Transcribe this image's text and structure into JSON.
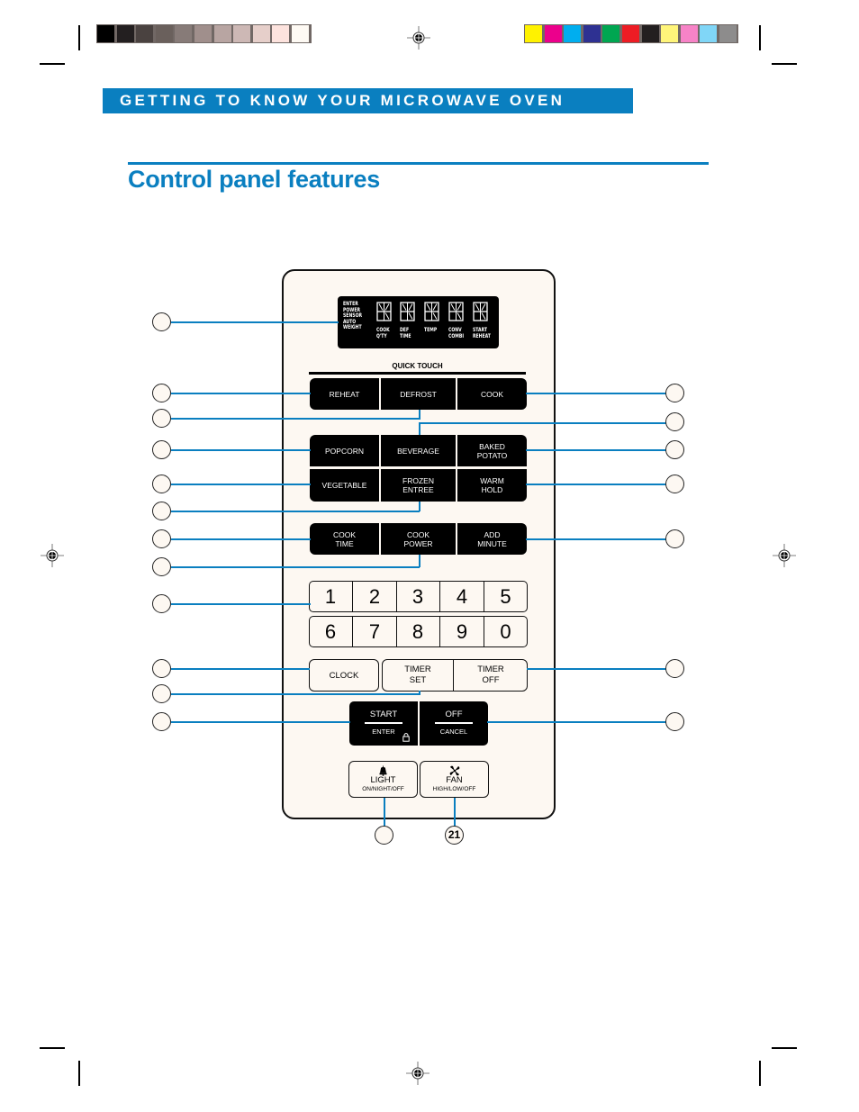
{
  "print_marks": {
    "gray_swatches": [
      "#000000",
      "#231f20",
      "#4a4240",
      "#6a605c",
      "#877b78",
      "#a08f8c",
      "#b8a5a2",
      "#cdb8b5",
      "#e6cfca",
      "#fde3de",
      "#fefaf4"
    ],
    "color_swatches": [
      "#fff200",
      "#ec008c",
      "#00aeef",
      "#2e3192",
      "#00a651",
      "#ed1c24",
      "#231f20",
      "#fff57a",
      "#f783c7",
      "#80d6f7",
      "#8d8c8c"
    ]
  },
  "header": {
    "section_banner": "GETTING TO KNOW YOUR MICROWAVE OVEN",
    "page_title": "Control panel features",
    "accent_color": "#0a7fc0"
  },
  "display": {
    "left_labels": "ENTER\nPOWER\nSENSOR\nAUTO\nWEIGHT",
    "digit_labels": [
      "COOK\nQ'TY",
      "DEF\nTIME",
      "TEMP",
      "CONV\nCOMBI",
      "START\nREHEAT"
    ]
  },
  "panel": {
    "quick_touch_label": "QUICK TOUCH",
    "row1": [
      "REHEAT",
      "DEFROST",
      "COOK"
    ],
    "row2": [
      "POPCORN",
      "BEVERAGE",
      "BAKED\nPOTATO"
    ],
    "row3": [
      "VEGETABLE",
      "FROZEN\nENTREE",
      "WARM\nHOLD"
    ],
    "row4": [
      "COOK\nTIME",
      "COOK\nPOWER",
      "ADD\nMINUTE"
    ],
    "keypad_row1": [
      "1",
      "2",
      "3",
      "4",
      "5"
    ],
    "keypad_row2": [
      "6",
      "7",
      "8",
      "9",
      "0"
    ],
    "clock": "CLOCK",
    "timer_set": "TIMER\nSET",
    "timer_off": "TIMER\nOFF",
    "start": {
      "label": "START",
      "sub": "ENTER"
    },
    "off": {
      "label": "OFF",
      "sub": "CANCEL"
    },
    "light": {
      "label": "LIGHT",
      "sub": "ON/NIGHT/OFF"
    },
    "fan": {
      "label": "FAN",
      "sub": "HIGH/LOW/OFF"
    }
  },
  "callouts": {
    "numbered_label": "21"
  }
}
